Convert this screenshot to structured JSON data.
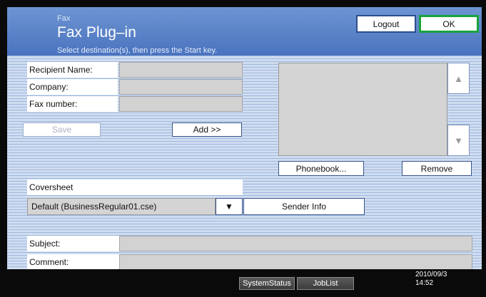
{
  "header": {
    "category": "Fax",
    "title": "Fax Plug–in",
    "instruction": "Select destination(s), then press the Start key.",
    "logout_label": "Logout",
    "ok_label": "OK"
  },
  "form": {
    "recipient_label": "Recipient Name:",
    "recipient_value": "",
    "company_label": "Company:",
    "company_value": "",
    "fax_label": "Fax number:",
    "fax_value": "",
    "save_label": "Save",
    "add_label": "Add >>"
  },
  "destinations": {
    "items": [],
    "phonebook_label": "Phonebook...",
    "remove_label": "Remove",
    "scroll_up_icon": "triangle-up-icon",
    "scroll_down_icon": "triangle-down-icon"
  },
  "coversheet": {
    "label": "Coversheet",
    "selected": "Default (BusinessRegular01.cse)",
    "sender_info_label": "Sender Info"
  },
  "message": {
    "subject_label": "Subject:",
    "subject_value": "",
    "comment_label": "Comment:",
    "comment_value": ""
  },
  "footer": {
    "system_status_label": "SystemStatus",
    "job_list_label": "JobList",
    "date": "2010/09/3",
    "time": "14:52"
  },
  "colors": {
    "header_blue": "#4a73bf",
    "ok_border": "#17a33b",
    "field_gray": "#d2d2d2"
  }
}
